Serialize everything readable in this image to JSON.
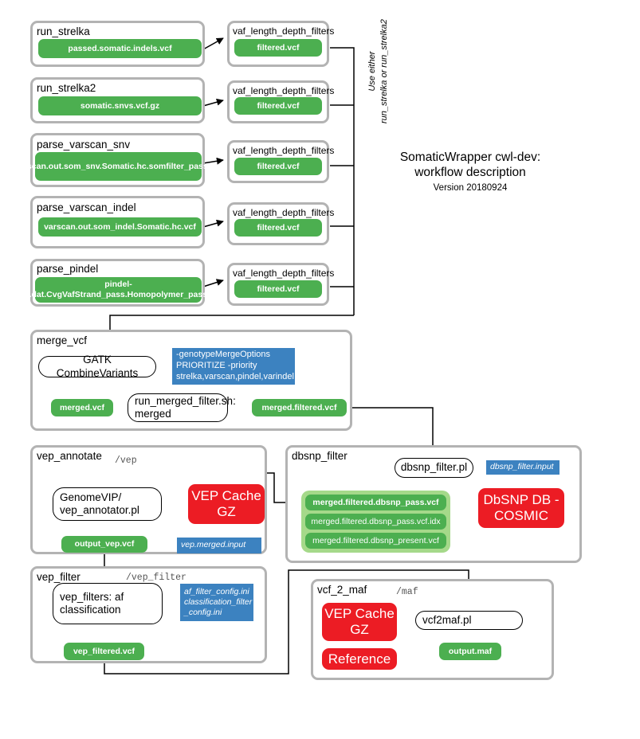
{
  "title": {
    "line1": "SomaticWrapper cwl-dev:",
    "line2": "workflow description",
    "version": "Version 20180924"
  },
  "notes": {
    "strelka_choice_line1": "Use either",
    "strelka_choice_line2": "run_strelka or run_strelka2"
  },
  "callers": [
    {
      "name": "run_strelka",
      "output": "passed.somatic.indels.vcf",
      "filter_step": "vaf_length_depth_filters",
      "filter_output": "filtered.vcf"
    },
    {
      "name": "run_strelka2",
      "output": "somatic.snvs.vcf.gz",
      "filter_step": "vaf_length_depth_filters",
      "filter_output": "filtered.vcf"
    },
    {
      "name": "parse_varscan_snv",
      "output": "varscan.out.som_snv.Somatic.hc.somfilter_pass.vcf",
      "filter_step": "vaf_length_depth_filters",
      "filter_output": "filtered.vcf"
    },
    {
      "name": "parse_varscan_indel",
      "output": "varscan.out.som_indel.Somatic.hc.vcf",
      "filter_step": "vaf_length_depth_filters",
      "filter_output": "filtered.vcf"
    },
    {
      "name": "parse_pindel",
      "output": "pindel-raw.dat.CvgVafStrand_pass.Homopolymer_pass.vcf",
      "filter_step": "vaf_length_depth_filters",
      "filter_output": "filtered.vcf"
    }
  ],
  "merge_vcf": {
    "title": "merge_vcf",
    "gatk": "GATK CombineVariants",
    "params": "-genotypeMergeOptions PRIORITIZE -priority strelka,varscan,pindel,varindel",
    "merged_vcf": "merged.vcf",
    "script": "run_merged_filter.sh: merged",
    "merged_filtered_vcf": "merged.filtered.vcf"
  },
  "dbsnp_filter": {
    "title": "dbsnp_filter",
    "script": "dbsnp_filter.pl",
    "input_config": "dbsnp_filter.input",
    "database": "DbSNP DB - COSMIC",
    "outputs": [
      "merged.filtered.dbsnp_pass.vcf",
      "merged.filtered.dbsnp_pass.vcf.idx",
      "merged.filtered.dbsnp_present.vcf"
    ]
  },
  "vep_annotate": {
    "title": "vep_annotate",
    "path": "/vep",
    "script": "GenomeVIP/ vep_annotator.pl",
    "cache": "VEP Cache GZ",
    "input_config": "vep.merged.input",
    "output": "output_vep.vcf"
  },
  "vep_filter": {
    "title": "vep_filter",
    "path": "/vep_filter",
    "script": "vep_filters: af classification",
    "configs": "af_filter_config.ini classification_filter _config.ini",
    "output": "vep_filtered.vcf"
  },
  "vcf_2_maf": {
    "title": "vcf_2_maf",
    "path": "/maf",
    "cache": "VEP Cache GZ",
    "reference": "Reference",
    "script": "vcf2maf.pl",
    "output": "output.maf"
  },
  "colors": {
    "file_green": "#4CAF50",
    "group_green": "#A5D98A",
    "param_blue": "#3C82C0",
    "resource_red": "#EC1C24",
    "box_border": "#b3b3b3",
    "wire": "#000000"
  }
}
